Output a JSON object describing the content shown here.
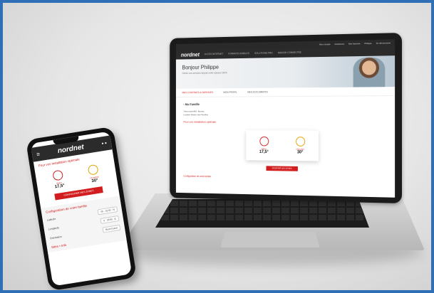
{
  "site": {
    "logo_text": "nordnet",
    "topbar": [
      "Mon compte",
      "Assistance",
      "Mes factures",
      "Philippe",
      "Se déconnecter"
    ],
    "nav": [
      "ACCÈS INTERNET",
      "FORFAITS MOBILES",
      "SOLUTIONS PRO",
      "MAISON CONNECTÉE"
    ],
    "hero": {
      "greeting": "Bonjour Philippe",
      "subtitle": "Gérez vos services depuis votre espace client"
    },
    "tabs": [
      "MES CONTRATS & SERVICES",
      "MON PROFIL",
      "MES DOCUMENTS"
    ],
    "back_label": "Ma Famille",
    "address": [
      "Thermostat #99 - Bureau",
      "Location Maison des Familles"
    ],
    "install_heading": "Pour vos installation optimale",
    "zones": [
      {
        "name": "Salon",
        "temp": "17,5°"
      },
      {
        "name": "Chambre",
        "temp": "30°"
      }
    ],
    "button_label": "MODIFIER LES ZONES",
    "config_heading": "Configuration de votre famille"
  },
  "phone": {
    "logo_text": "nordnet",
    "menu_icon": "menu-icon",
    "heading": "Pour vos installation optimale",
    "zones": [
      {
        "name": "Salon",
        "temp": "17,5°"
      },
      {
        "name": "Chambre",
        "temp": "30°"
      }
    ],
    "button_label": "CONFIGURER MES ZONES",
    "config_heading": "Configuration de votre famille",
    "rows": [
      {
        "label": "Latitude",
        "value": "45 · 32'30 · N"
      },
      {
        "label": "Longitude",
        "value": "0 · 35'55 · E"
      },
      {
        "label": "Orientation",
        "value": "Nord-Ouest"
      }
    ],
    "link": "Sites • Info"
  },
  "colors": {
    "frame": "#2f6fb5",
    "accent": "#d11d1d",
    "nav_dark": "#2b2b2b"
  }
}
